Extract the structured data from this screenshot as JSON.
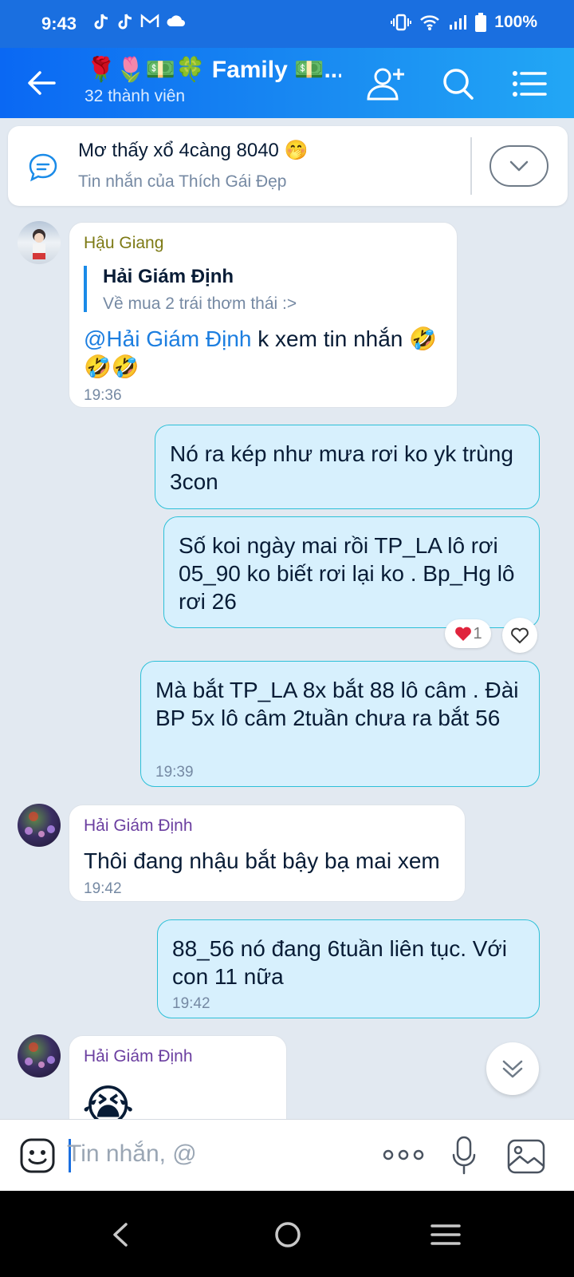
{
  "status_bar": {
    "time": "9:43",
    "notification_icons": [
      "tiktok-icon",
      "tiktok-icon",
      "gmail-icon",
      "cloud-icon"
    ],
    "battery": "100%"
  },
  "header": {
    "title": "🌹🌷💵🍀 Family 💵...",
    "subtitle": "32 thành viên",
    "accent_color": "#0a68f3"
  },
  "pinned": {
    "text": "Mơ thấy xổ 4càng 8040 🤭",
    "subtext": "Tin nhắn của Thích Gái Đẹp"
  },
  "messages": [
    {
      "sender": "Hậu Giang",
      "quote_author": "Hải Giám Định",
      "quote_text": "Về mua 2 trái thơm thái :>",
      "mention": "@Hải Giám Định",
      "text_line1": " k xem tin nhắn 🤣",
      "text_line2": "🤣🤣",
      "time": "19:36"
    },
    {
      "text": "Nó ra kép như mưa rơi ko yk trùng 3con"
    },
    {
      "text": "Số koi ngày mai rồi TP_LA lô rơi 05_90 ko biết rơi lại ko . Bp_Hg lô rơi 26",
      "reaction_count": "1"
    },
    {
      "text": "Mà bắt TP_LA 8x bắt 88 lô câm . Đài BP 5x lô câm 2tuần chưa ra bắt 56",
      "time": "19:39"
    },
    {
      "sender": "Hải Giám Định",
      "text": "Thôi đang nhậu bắt bậy bạ mai xem",
      "time": "19:42"
    },
    {
      "text": "88_56 nó đang 6tuần liên tục. Với con 11 nữa",
      "time": "19:42"
    },
    {
      "sender": "Hải Giám Định",
      "sticker": "😭"
    }
  ],
  "input": {
    "placeholder": "Tin nhắn, @"
  }
}
